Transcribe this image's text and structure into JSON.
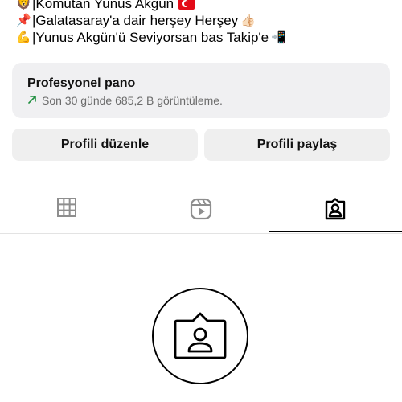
{
  "bio": {
    "lines": [
      {
        "emoji": "🦁",
        "text": "|Komutan Yunus Akgün",
        "flag": "tr-flag"
      },
      {
        "emoji": "📌",
        "text": "|Galatasaray'a dair herşey Herşey",
        "trail_emoji": "👍🏻"
      },
      {
        "emoji": "💪",
        "text": "|Yunus Akgün'ü Seviyorsan bas Takip'e",
        "trail_emoji": "📲"
      }
    ]
  },
  "dashboard": {
    "title": "Profesyonel pano",
    "stats": "Son 30 günde 685,2 B görüntüleme.",
    "arrow_icon": "trend-up-icon",
    "arrow_color": "#1e8e3e"
  },
  "buttons": {
    "edit_profile": "Profili düzenle",
    "share_profile": "Profili paylaş"
  },
  "tabs": [
    {
      "name": "posts",
      "icon": "grid-icon"
    },
    {
      "name": "reels",
      "icon": "reels-icon"
    },
    {
      "name": "tagged",
      "icon": "tagged-icon",
      "active": true
    }
  ],
  "empty_state": {
    "icon": "tagged-person-icon"
  },
  "colors": {
    "card_bg": "#f0f0f2",
    "button_bg": "#efefef",
    "active_tab": "#000000"
  }
}
